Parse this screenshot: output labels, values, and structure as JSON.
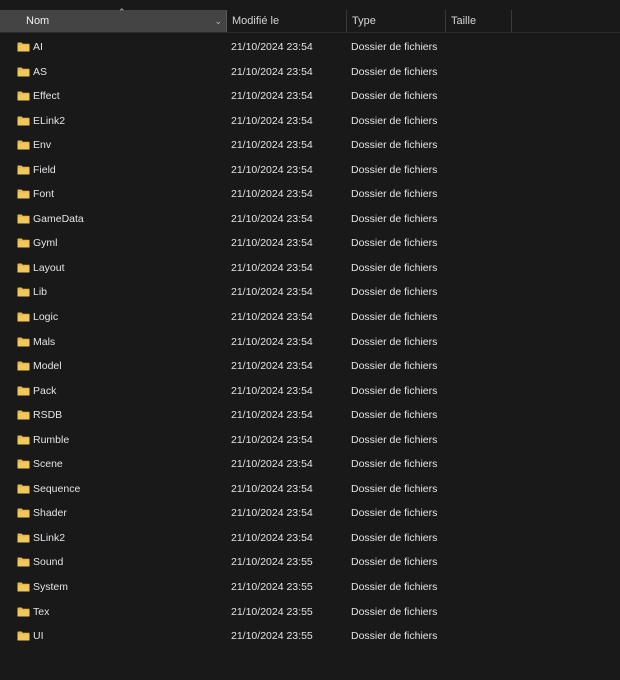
{
  "columns": {
    "name": "Nom",
    "modified": "Modifié le",
    "type": "Type",
    "size": "Taille"
  },
  "colors": {
    "background": "#191919",
    "header_active": "#444444",
    "folder": "#e8b84a"
  },
  "icons": {
    "folder": "folder-icon",
    "sort": "sort-ascending-icon"
  },
  "files": [
    {
      "name": "AI",
      "modified": "21/10/2024 23:54",
      "type": "Dossier de fichiers"
    },
    {
      "name": "AS",
      "modified": "21/10/2024 23:54",
      "type": "Dossier de fichiers"
    },
    {
      "name": "Effect",
      "modified": "21/10/2024 23:54",
      "type": "Dossier de fichiers"
    },
    {
      "name": "ELink2",
      "modified": "21/10/2024 23:54",
      "type": "Dossier de fichiers"
    },
    {
      "name": "Env",
      "modified": "21/10/2024 23:54",
      "type": "Dossier de fichiers"
    },
    {
      "name": "Field",
      "modified": "21/10/2024 23:54",
      "type": "Dossier de fichiers"
    },
    {
      "name": "Font",
      "modified": "21/10/2024 23:54",
      "type": "Dossier de fichiers"
    },
    {
      "name": "GameData",
      "modified": "21/10/2024 23:54",
      "type": "Dossier de fichiers"
    },
    {
      "name": "Gyml",
      "modified": "21/10/2024 23:54",
      "type": "Dossier de fichiers"
    },
    {
      "name": "Layout",
      "modified": "21/10/2024 23:54",
      "type": "Dossier de fichiers"
    },
    {
      "name": "Lib",
      "modified": "21/10/2024 23:54",
      "type": "Dossier de fichiers"
    },
    {
      "name": "Logic",
      "modified": "21/10/2024 23:54",
      "type": "Dossier de fichiers"
    },
    {
      "name": "Mals",
      "modified": "21/10/2024 23:54",
      "type": "Dossier de fichiers"
    },
    {
      "name": "Model",
      "modified": "21/10/2024 23:54",
      "type": "Dossier de fichiers"
    },
    {
      "name": "Pack",
      "modified": "21/10/2024 23:54",
      "type": "Dossier de fichiers"
    },
    {
      "name": "RSDB",
      "modified": "21/10/2024 23:54",
      "type": "Dossier de fichiers"
    },
    {
      "name": "Rumble",
      "modified": "21/10/2024 23:54",
      "type": "Dossier de fichiers"
    },
    {
      "name": "Scene",
      "modified": "21/10/2024 23:54",
      "type": "Dossier de fichiers"
    },
    {
      "name": "Sequence",
      "modified": "21/10/2024 23:54",
      "type": "Dossier de fichiers"
    },
    {
      "name": "Shader",
      "modified": "21/10/2024 23:54",
      "type": "Dossier de fichiers"
    },
    {
      "name": "SLink2",
      "modified": "21/10/2024 23:54",
      "type": "Dossier de fichiers"
    },
    {
      "name": "Sound",
      "modified": "21/10/2024 23:55",
      "type": "Dossier de fichiers"
    },
    {
      "name": "System",
      "modified": "21/10/2024 23:55",
      "type": "Dossier de fichiers"
    },
    {
      "name": "Tex",
      "modified": "21/10/2024 23:55",
      "type": "Dossier de fichiers"
    },
    {
      "name": "UI",
      "modified": "21/10/2024 23:55",
      "type": "Dossier de fichiers"
    }
  ]
}
